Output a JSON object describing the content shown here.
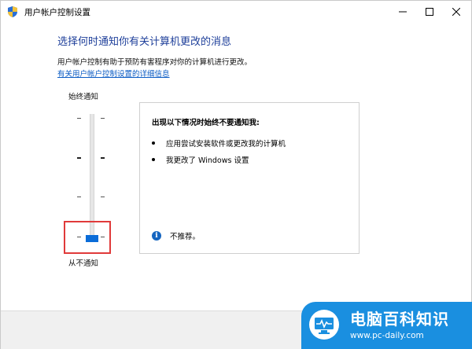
{
  "window": {
    "title": "用户帐户控制设置",
    "controls": [
      "minimize",
      "maximize",
      "close"
    ]
  },
  "main": {
    "heading": "选择何时通知你有关计算机更改的消息",
    "description": "用户帐户控制有助于预防有害程序对你的计算机进行更改。",
    "link": "有关用户帐户控制设置的详细信息"
  },
  "slider": {
    "top_label": "始终通知",
    "bottom_label": "从不通知",
    "levels": 4,
    "selected_level": 1,
    "selected_level_note": "1 of 4 from bottom (lowest)"
  },
  "info_panel": {
    "title": "出现以下情况时始终不要通知我:",
    "items": [
      "应用尝试安装软件或更改我的计算机",
      "我更改了 Windows 设置"
    ],
    "note": "不推荐。"
  },
  "watermark": {
    "brand": "电脑百科知识",
    "url": "www.pc-daily.com"
  },
  "colors": {
    "heading": "#1e3f9a",
    "link": "#0a5bc4",
    "thumb": "#0a6cd8",
    "highlight": "#e03a3a",
    "watermark_bg": "#1a8fe0",
    "info_icon": "#1565c0"
  },
  "icons": {
    "app": "uac-shield-icon",
    "info": "info-circle-icon",
    "watermark_logo": "monitor-pulse-icon"
  }
}
